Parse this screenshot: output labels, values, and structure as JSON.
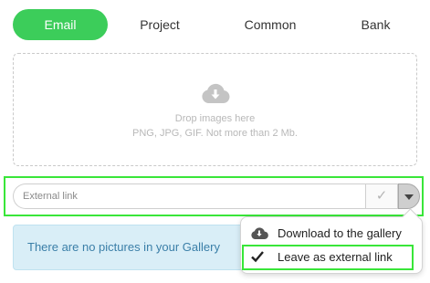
{
  "tabs": [
    {
      "label": "Email",
      "active": true
    },
    {
      "label": "Project",
      "active": false
    },
    {
      "label": "Common",
      "active": false
    },
    {
      "label": "Bank",
      "active": false
    }
  ],
  "dropzone": {
    "icon": "cloud-download-icon",
    "line1": "Drop images here",
    "line2": "PNG, JPG, GIF. Not more than 2 Mb."
  },
  "link_input": {
    "placeholder": "External link",
    "value": "",
    "confirm_icon": "check-icon",
    "dropdown_icon": "chevron-down-icon"
  },
  "gallery_info": {
    "text": "There are no pictures in your Gallery"
  },
  "menu": {
    "items": [
      {
        "label": "Download to the gallery",
        "icon": "cloud-download-icon",
        "selected": false
      },
      {
        "label": "Leave as external link",
        "icon": "check-icon",
        "selected": true
      }
    ]
  },
  "colors": {
    "accent": "#3ccd5a",
    "highlight": "#39e639",
    "info_bg": "#d9eef7",
    "info_text": "#3b7fa8"
  }
}
